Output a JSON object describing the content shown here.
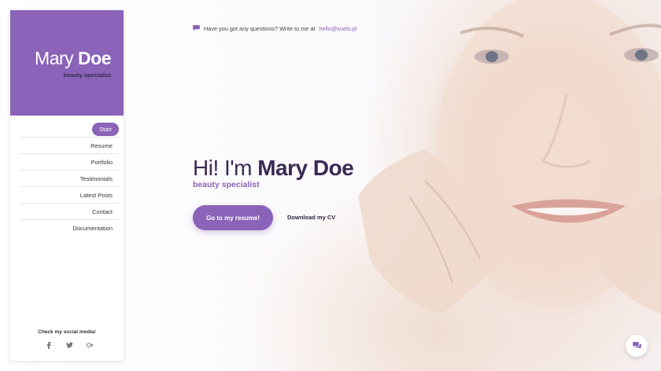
{
  "sidebar": {
    "first_name": "Mary",
    "last_name": "Doe",
    "role": "beauty specialist",
    "items": [
      {
        "label": "Start",
        "active": true
      },
      {
        "label": "Resume"
      },
      {
        "label": "Portfolio"
      },
      {
        "label": "Testimonials"
      },
      {
        "label": "Latest Posts"
      },
      {
        "label": "Contact"
      },
      {
        "label": "Documentation"
      }
    ],
    "social_title": "Check my social media!",
    "social_icons": [
      "facebook-icon",
      "twitter-icon",
      "google-plus-icon"
    ]
  },
  "contact": {
    "text": "Have you got any questions? Write to me at",
    "email": "hello@suelo.pl"
  },
  "hero": {
    "greeting": "Hi! I'm",
    "name": "Mary Doe",
    "subtitle": "beauty specialist",
    "primary_button": "Go to my resume!",
    "secondary_button": "Download my CV"
  },
  "colors": {
    "accent": "#8b63b8",
    "dark_text": "#3a2a55"
  },
  "icons": {
    "contact": "chat-bubble-icon",
    "chat_button": "chat-bubbles-icon"
  }
}
